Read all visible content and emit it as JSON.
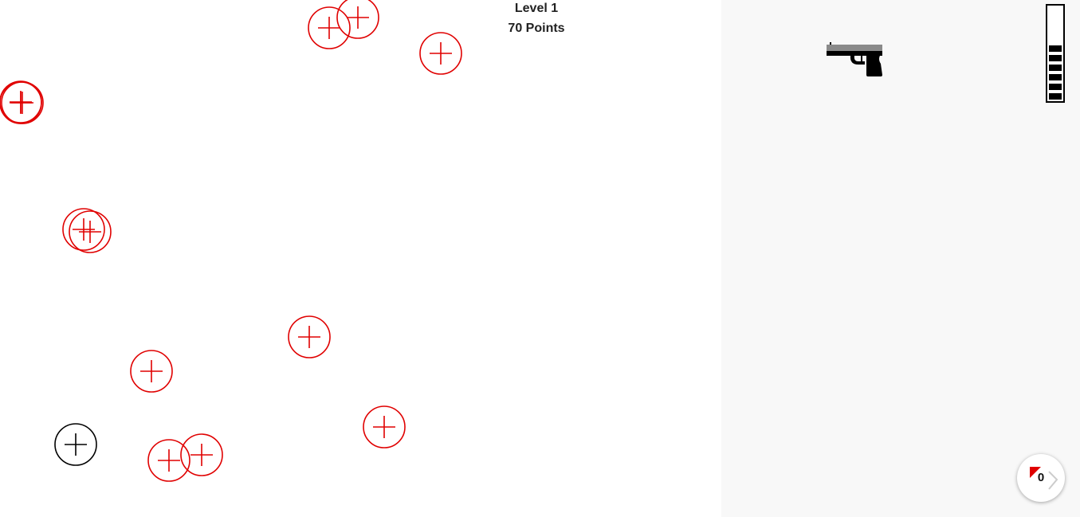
{
  "hud": {
    "level_text": "Level 1",
    "points_text": "70 Points"
  },
  "colors": {
    "target_active": "#e00000",
    "target_selected": "#000000",
    "side_panel": "#f8f8f8",
    "badge_flag": "#e00000"
  },
  "targets": [
    {
      "state": "active"
    },
    {
      "state": "active"
    },
    {
      "state": "active"
    },
    {
      "state": "active"
    },
    {
      "state": "active"
    },
    {
      "state": "active"
    },
    {
      "state": "active"
    },
    {
      "state": "active"
    },
    {
      "state": "active"
    },
    {
      "state": "selected"
    },
    {
      "state": "active"
    },
    {
      "state": "active"
    },
    {
      "state": "active"
    },
    {
      "state": "active"
    }
  ],
  "weapon": {
    "icon": "pistol-icon"
  },
  "ammo": {
    "loaded": 6,
    "capacity": 10
  },
  "counter_badge": {
    "value": "0",
    "icon": "flag-icon"
  }
}
